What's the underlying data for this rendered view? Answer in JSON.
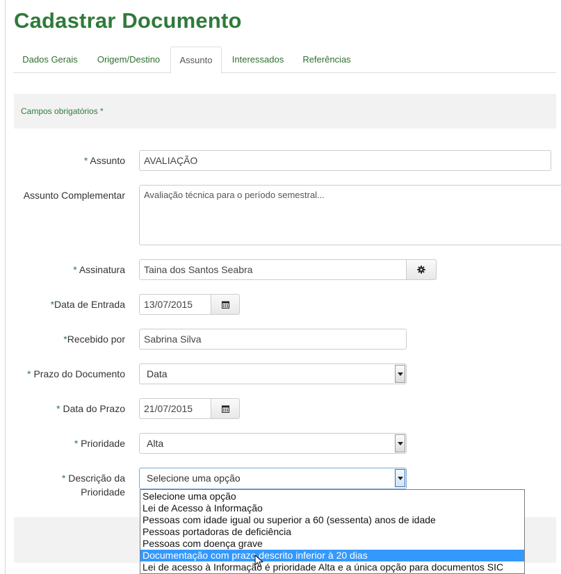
{
  "page_title": "Cadastrar Documento",
  "tabs": [
    {
      "label": "Dados Gerais"
    },
    {
      "label": "Origem/Destino"
    },
    {
      "label": "Assunto"
    },
    {
      "label": "Interessados"
    },
    {
      "label": "Referências"
    }
  ],
  "active_tab": "Assunto",
  "required_note": "Campos obrigatórios *",
  "form": {
    "assunto": {
      "label": "Assunto",
      "value": "AVALIAÇÃO"
    },
    "assunto_complementar": {
      "label": "Assunto Complementar",
      "value": "Avaliação técnica para o período semestral..."
    },
    "assinatura": {
      "label": "Assinatura",
      "value": "Taina dos Santos Seabra",
      "button_icon": "gear-icon"
    },
    "data_entrada": {
      "label": "Data de Entrada",
      "value": "13/07/2015",
      "button_icon": "calendar-icon"
    },
    "recebido_por": {
      "label": "Recebido por",
      "value": "Sabrina Silva"
    },
    "prazo_documento": {
      "label": "Prazo do Documento",
      "value": "Data"
    },
    "data_prazo": {
      "label": "Data do Prazo",
      "value": "21/07/2015",
      "button_icon": "calendar-icon"
    },
    "prioridade": {
      "label": "Prioridade",
      "value": "Alta"
    },
    "descricao_prioridade": {
      "label_line1": "Descrição da",
      "label_line2": "Prioridade",
      "value": "Selecione uma opção"
    }
  },
  "required_marker": "*",
  "dropdown_options": [
    "Selecione uma opção",
    "Lei de Acesso à Informação",
    "Pessoas com idade igual ou superior a 60 (sessenta) anos de idade",
    "Pessoas portadoras de deficiência",
    "Pessoas com doença grave",
    "Documentação com prazo descrito inferior à 20 dias",
    "Lei de acesso à Informação é prioridade Alta e a única opção para documentos SIC"
  ],
  "highlighted_option": "Documentação com prazo descrito inferior à 20 dias",
  "colors": {
    "title_green": "#2f7a3a",
    "highlight_blue": "#3399ff"
  }
}
